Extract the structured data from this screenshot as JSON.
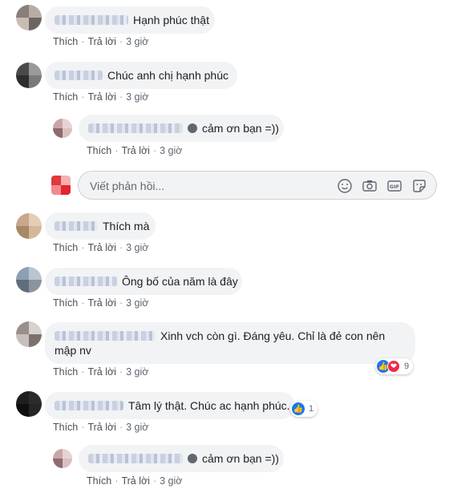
{
  "actions": {
    "like": "Thích",
    "reply": "Trả lời",
    "sep": "·"
  },
  "reply_box": {
    "placeholder": "Viết phản hồi..."
  },
  "comments": [
    {
      "text": "Hạnh phúc thật",
      "time": "3 giờ"
    },
    {
      "text": "Chúc anh chị hạnh phúc",
      "time": "3 giờ",
      "reply": {
        "text": "cảm ơn bạn =))",
        "time": "3 giờ"
      }
    },
    {
      "text": "Thích mà",
      "time": "3 giờ"
    },
    {
      "text": "Ông bố của năm là đây",
      "time": "3 giờ"
    },
    {
      "text": "Xinh vch còn gì. Đáng yêu. Chỉ là đẻ con nên mập nv",
      "time": "3 giờ",
      "reactions": {
        "count": "9",
        "types": [
          "like",
          "love"
        ]
      }
    },
    {
      "text": "Tâm lý thật. Chúc ac hạnh phúc.",
      "time": "3 giờ",
      "reactions": {
        "count": "1",
        "types": [
          "like"
        ]
      },
      "reply": {
        "text": "cảm ơn bạn =))",
        "time": "3 giờ"
      }
    }
  ],
  "icons": {
    "emoji": "emoji-icon",
    "camera": "camera-icon",
    "gif": "gif-icon",
    "sticker": "sticker-icon",
    "verified": "verified-badge-icon"
  },
  "colors": {
    "bubble": "#f2f3f5",
    "link": "#4b4f56",
    "meta": "#606770",
    "like": "#1877f2",
    "love": "#f0284a"
  }
}
